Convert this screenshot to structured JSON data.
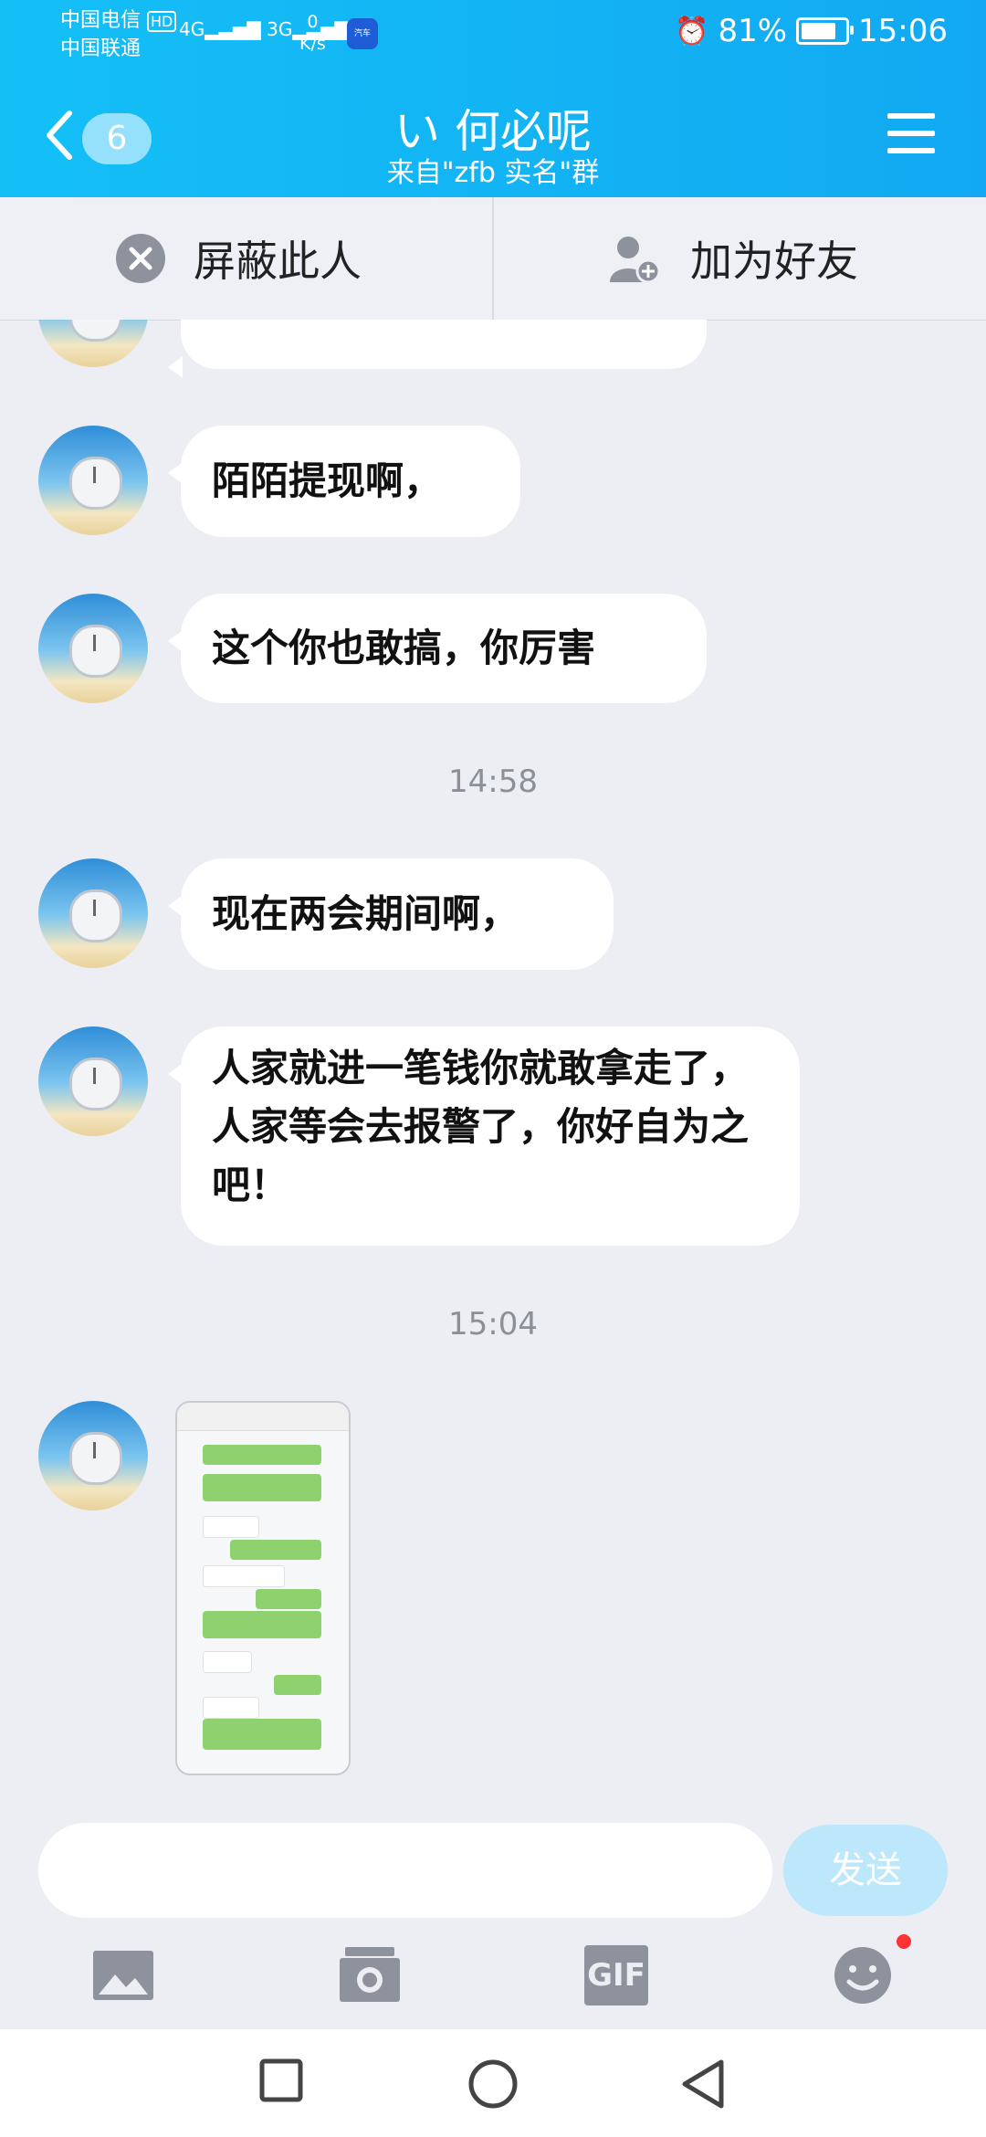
{
  "status_bar": {
    "carrier1": "中国电信",
    "hd": "HD",
    "carrier2": "中国联通",
    "net1": "4G",
    "net2": "3G",
    "speed_value": "0",
    "speed_unit": "K/s",
    "alarm": "⏰",
    "battery_text": "81%",
    "battery_level": 0.81,
    "time": "15:06"
  },
  "header": {
    "badge_count": "6",
    "title": "い 何必呢",
    "subtitle": "来自\"zfb 实名\"群"
  },
  "actions": {
    "block_label": "屏蔽此人",
    "add_label": "加为好友"
  },
  "messages": [
    {
      "text": "陌陌提现啊，"
    },
    {
      "text": "这个你也敢搞，你厉害"
    },
    {
      "time": "14:58"
    },
    {
      "text": "现在两会期间啊，"
    },
    {
      "text": "人家就进一笔钱你就敢拿走了，人家等会去报警了，你好自为之吧！"
    },
    {
      "time": "15:04"
    }
  ],
  "input": {
    "send_label": "发送"
  },
  "toolbar": {
    "gif_label": "GIF"
  },
  "colors": {
    "header": "#12b6f4",
    "send_disabled": "#bde8fb",
    "chat_bg": "#eceef4"
  }
}
